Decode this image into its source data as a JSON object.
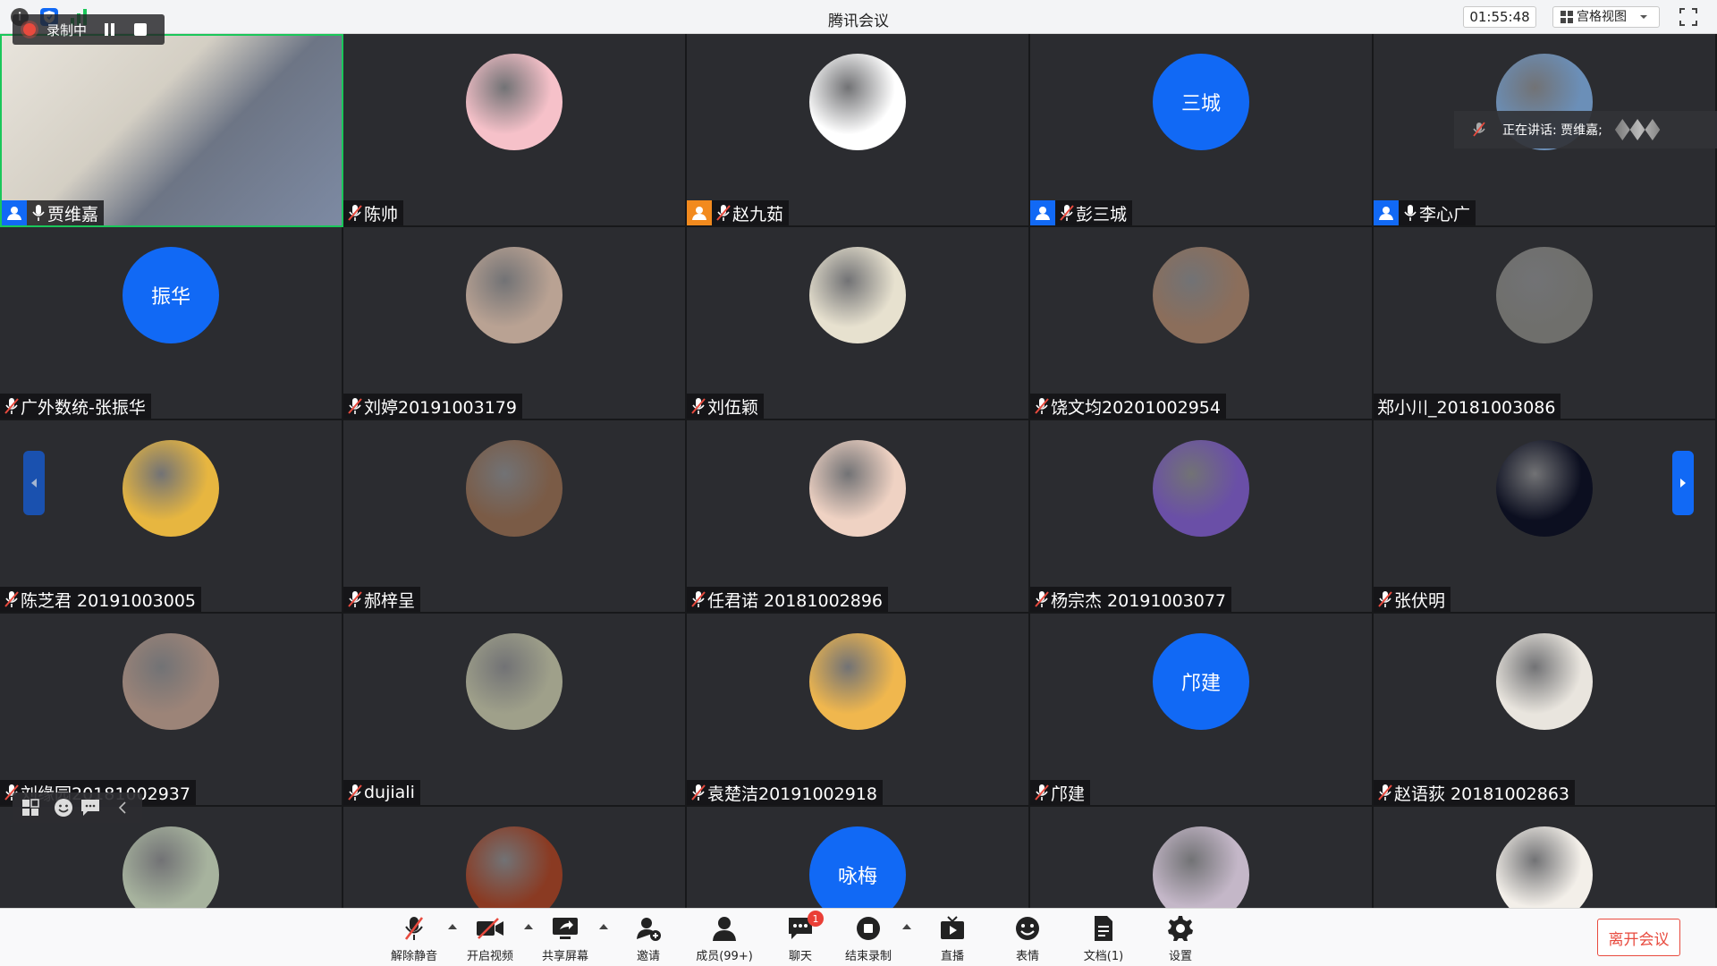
{
  "window": {
    "title": "腾讯会议",
    "time": "01:55:48",
    "view_mode": "宫格视图"
  },
  "recording": {
    "label": "录制中"
  },
  "speaking": {
    "label": "正在讲话: 贾维嘉;"
  },
  "participants": [
    {
      "name": "贾维嘉",
      "mic": "on",
      "host": "blue",
      "avatar_type": "video"
    },
    {
      "name": "陈帅",
      "mic": "off",
      "avatar_type": "image",
      "avatar_color": "#f6c1c9"
    },
    {
      "name": "赵九茹",
      "mic": "off",
      "host": "orange",
      "avatar_type": "image",
      "avatar_color": "#ffffff"
    },
    {
      "name": "彭三城",
      "mic": "off",
      "host": "blue",
      "avatar_type": "text",
      "avatar_text": "三城"
    },
    {
      "name": "李心广",
      "mic": "on",
      "host": "blue",
      "avatar_type": "image",
      "avatar_color": "#6b8fb8"
    },
    {
      "name": "广外数统-张振华",
      "mic": "off",
      "avatar_type": "text",
      "avatar_text": "振华"
    },
    {
      "name": "刘婷20191003179",
      "mic": "off",
      "avatar_type": "image",
      "avatar_color": "#b9a293"
    },
    {
      "name": "刘伍颖",
      "mic": "off",
      "avatar_type": "image",
      "avatar_color": "#e7e1cf"
    },
    {
      "name": "饶文均20201002954",
      "mic": "off",
      "avatar_type": "image",
      "avatar_color": "#8b6e5b"
    },
    {
      "name": "郑小川_20181003086",
      "mic": "none",
      "avatar_type": "image",
      "avatar_color": "#6f6f6c"
    },
    {
      "name": "陈芝君 20191003005",
      "mic": "off",
      "avatar_type": "image",
      "avatar_color": "#e7b640"
    },
    {
      "name": "郝梓呈",
      "mic": "off",
      "avatar_type": "image",
      "avatar_color": "#7a5b46"
    },
    {
      "name": "任君诺 20181002896",
      "mic": "off",
      "avatar_type": "image",
      "avatar_color": "#efd2c3"
    },
    {
      "name": "杨宗杰 20191003077",
      "mic": "off",
      "avatar_type": "image",
      "avatar_color": "#6a4fa7"
    },
    {
      "name": "张伏明",
      "mic": "off",
      "avatar_type": "image",
      "avatar_color": "#0c0f20"
    },
    {
      "name": "刘缘园20181002937",
      "mic": "off",
      "avatar_type": "image",
      "avatar_color": "#9c8478"
    },
    {
      "name": "dujiali",
      "mic": "off",
      "avatar_type": "image",
      "avatar_color": "#9fa08a"
    },
    {
      "name": "袁楚洁20191002918",
      "mic": "off",
      "avatar_type": "image",
      "avatar_color": "#f0b74e"
    },
    {
      "name": "邝建",
      "mic": "off",
      "avatar_type": "text",
      "avatar_text": "邝建"
    },
    {
      "name": "赵语荻 20181002863",
      "mic": "off",
      "avatar_type": "image",
      "avatar_color": "#e9e5de"
    },
    {
      "name": "",
      "mic": "none",
      "avatar_type": "image",
      "avatar_color": "#a7b39e"
    },
    {
      "name": "",
      "mic": "none",
      "avatar_type": "image",
      "avatar_color": "#8a3a22"
    },
    {
      "name": "",
      "mic": "none",
      "avatar_type": "text",
      "avatar_text": "咏梅"
    },
    {
      "name": "",
      "mic": "none",
      "avatar_type": "image",
      "avatar_color": "#c4b7c8"
    },
    {
      "name": "",
      "mic": "none",
      "avatar_type": "image",
      "avatar_color": "#f3efe9"
    }
  ],
  "toolbar": {
    "unmute": "解除静音",
    "start_video": "开启视频",
    "share_screen": "共享屏幕",
    "invite": "邀请",
    "members": "成员(99+)",
    "chat": "聊天",
    "chat_badge": "1",
    "end_recording": "结束录制",
    "live": "直播",
    "reactions": "表情",
    "docs": "文档(1)",
    "settings": "设置",
    "leave": "离开会议"
  },
  "colors": {
    "accent": "#1169f5",
    "active_border": "#1ac75a",
    "leave": "#e84a3e",
    "host_orange": "#f28a1e"
  }
}
